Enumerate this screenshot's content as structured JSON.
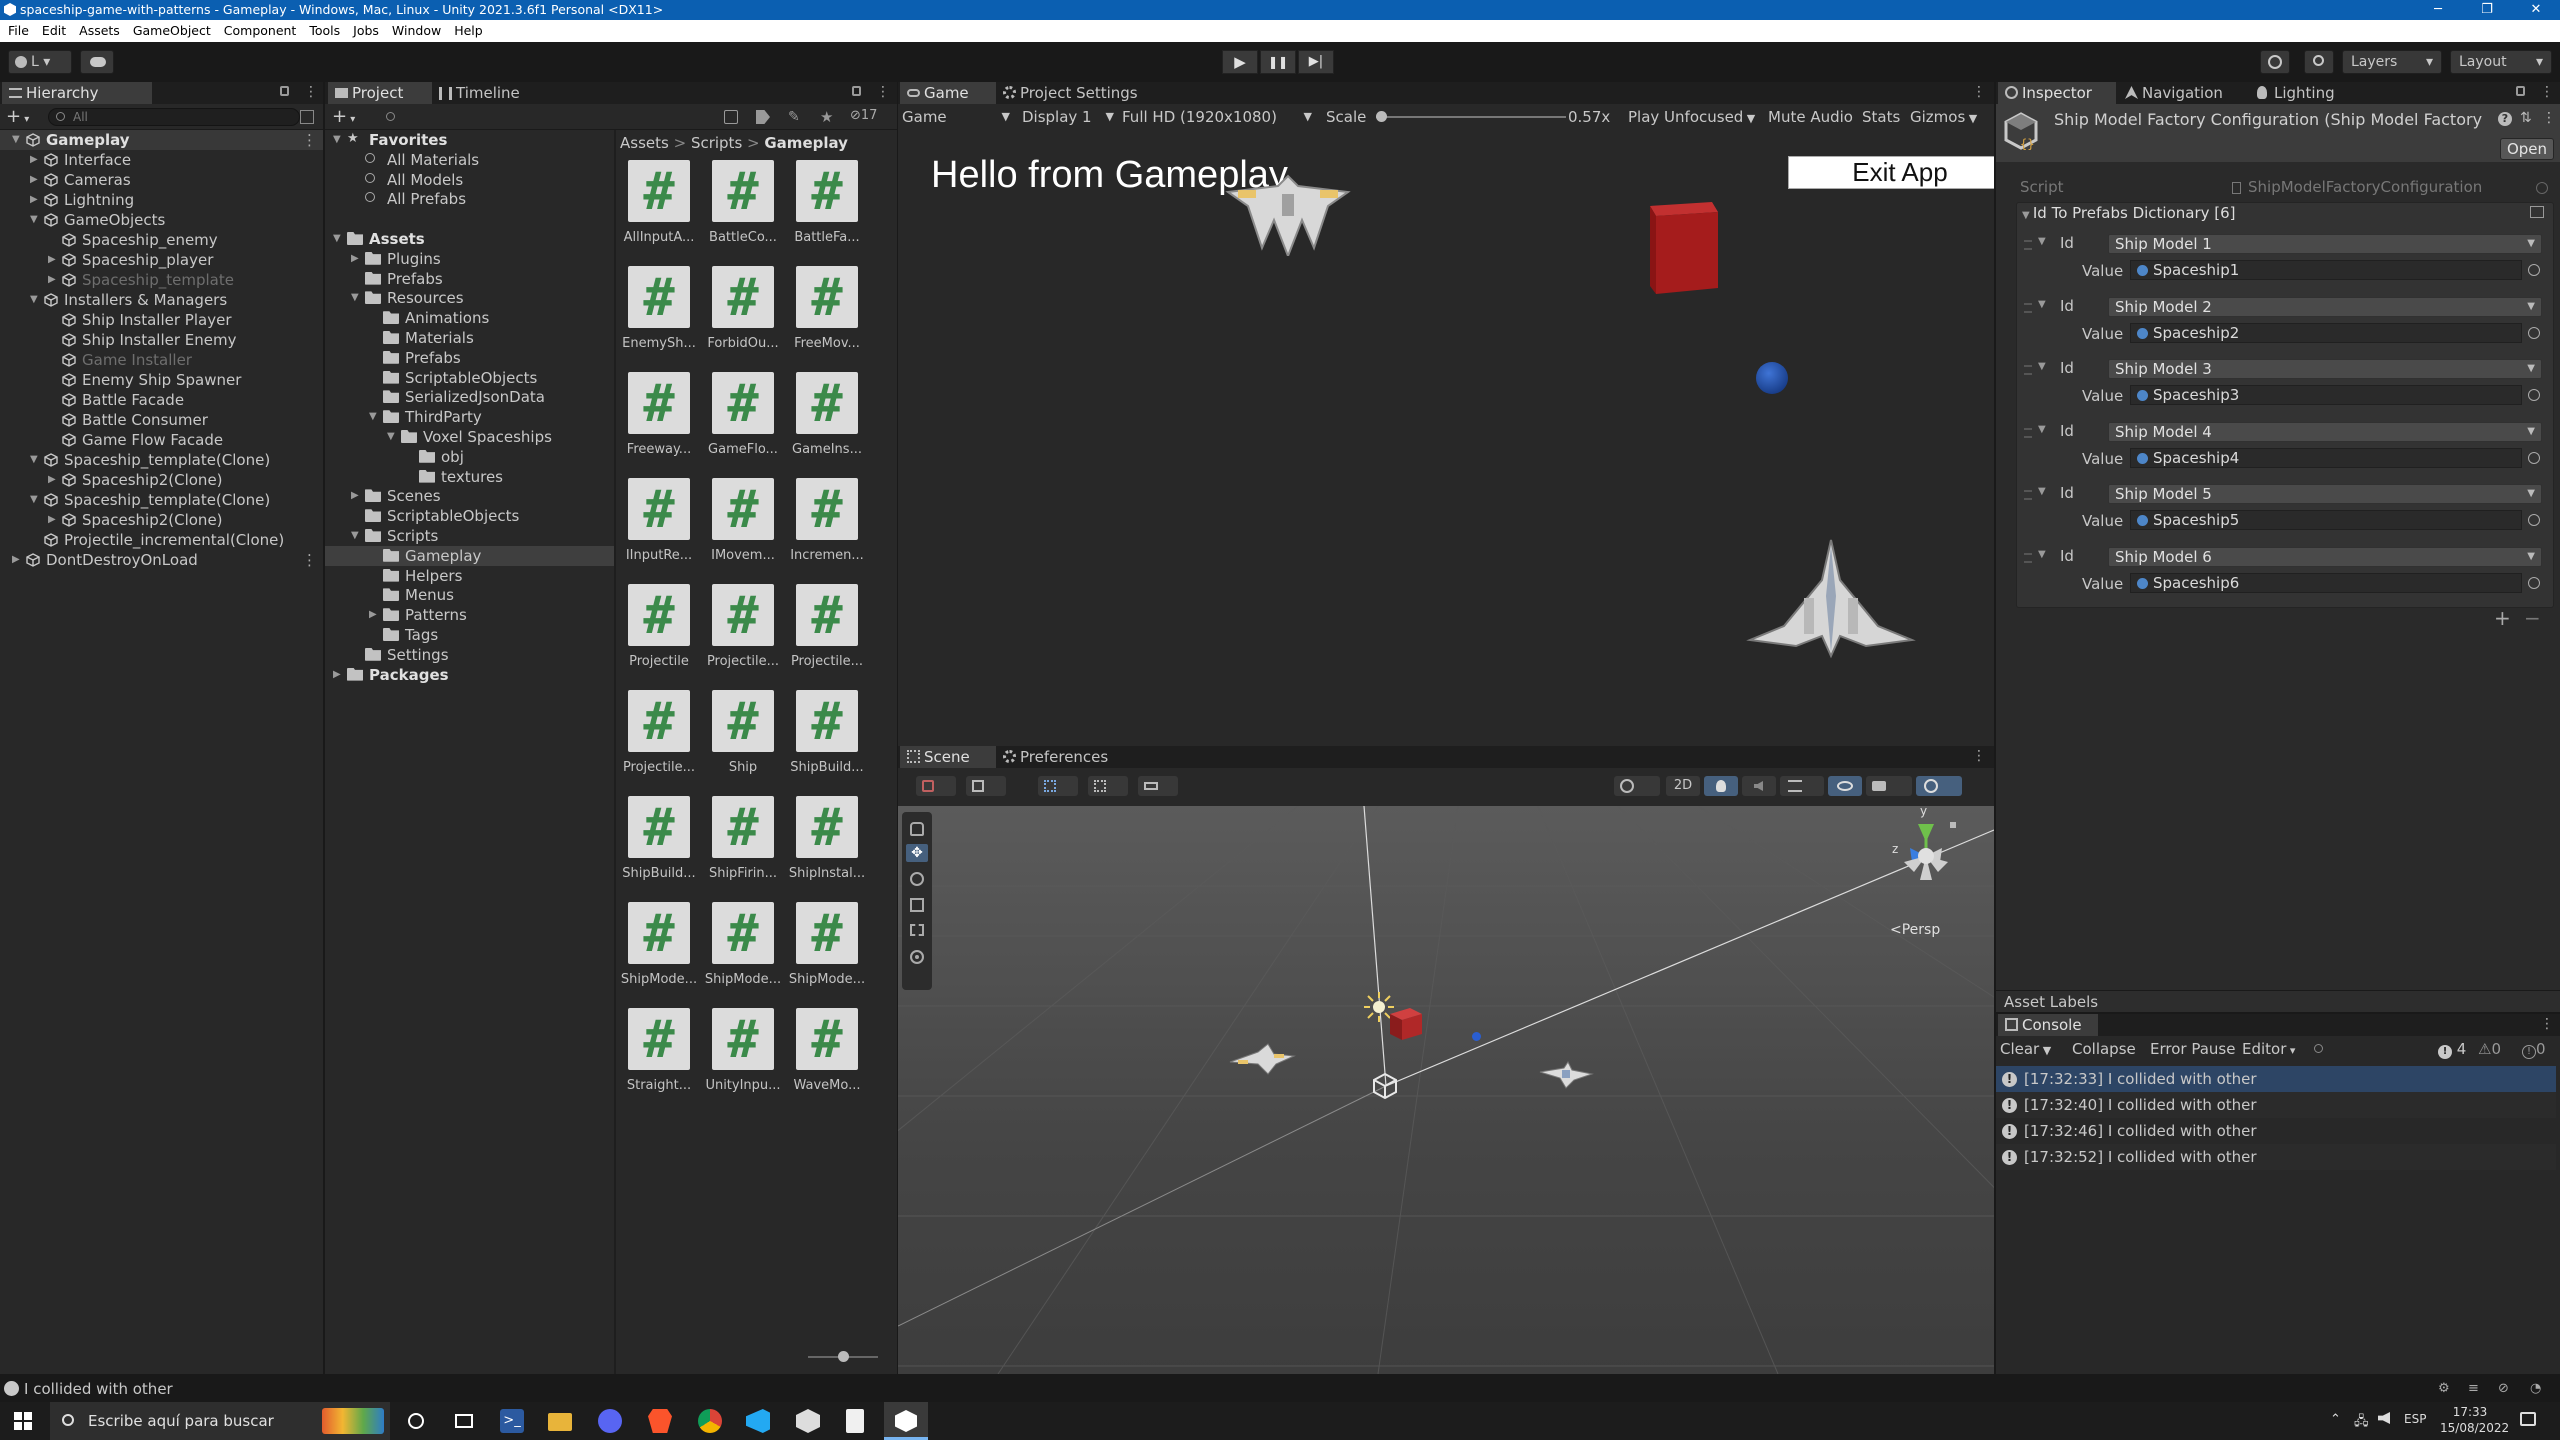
{
  "window": {
    "title": "spaceship-game-with-patterns - Gameplay - Windows, Mac, Linux - Unity 2021.3.6f1 Personal <DX11>"
  },
  "menu": [
    "File",
    "Edit",
    "Assets",
    "GameObject",
    "Component",
    "Tools",
    "Jobs",
    "Window",
    "Help"
  ],
  "toolbar": {
    "account": "L",
    "layers": "Layers",
    "layout": "Layout"
  },
  "hierarchy": {
    "tab": "Hierarchy",
    "search_placeholder": "All",
    "rows": [
      {
        "label": "Gameplay",
        "depth": 0,
        "arrow": "open",
        "icon": "scene",
        "bold": true,
        "sel": true
      },
      {
        "label": "Interface",
        "depth": 1,
        "arrow": "closed",
        "icon": "cube"
      },
      {
        "label": "Cameras",
        "depth": 1,
        "arrow": "closed",
        "icon": "cube"
      },
      {
        "label": "Lightning",
        "depth": 1,
        "arrow": "closed",
        "icon": "cube"
      },
      {
        "label": "GameObjects",
        "depth": 1,
        "arrow": "open",
        "icon": "cube"
      },
      {
        "label": "Spaceship_enemy",
        "depth": 2,
        "arrow": "none",
        "icon": "cube"
      },
      {
        "label": "Spaceship_player",
        "depth": 2,
        "arrow": "closed",
        "icon": "cube"
      },
      {
        "label": "Spaceship_template",
        "depth": 2,
        "arrow": "closed",
        "icon": "cube",
        "gray": true
      },
      {
        "label": "Installers & Managers",
        "depth": 1,
        "arrow": "open",
        "icon": "cube"
      },
      {
        "label": "Ship Installer Player",
        "depth": 2,
        "arrow": "none",
        "icon": "cube"
      },
      {
        "label": "Ship Installer Enemy",
        "depth": 2,
        "arrow": "none",
        "icon": "cube"
      },
      {
        "label": "Game Installer",
        "depth": 2,
        "arrow": "none",
        "icon": "cube",
        "gray": true
      },
      {
        "label": "Enemy Ship Spawner",
        "depth": 2,
        "arrow": "none",
        "icon": "cube"
      },
      {
        "label": "Battle Facade",
        "depth": 2,
        "arrow": "none",
        "icon": "cube"
      },
      {
        "label": "Battle Consumer",
        "depth": 2,
        "arrow": "none",
        "icon": "cube"
      },
      {
        "label": "Game Flow Facade",
        "depth": 2,
        "arrow": "none",
        "icon": "cube"
      },
      {
        "label": "Spaceship_template(Clone)",
        "depth": 1,
        "arrow": "open",
        "icon": "cube"
      },
      {
        "label": "Spaceship2(Clone)",
        "depth": 2,
        "arrow": "closed",
        "icon": "cube"
      },
      {
        "label": "Spaceship_template(Clone)",
        "depth": 1,
        "arrow": "open",
        "icon": "cube"
      },
      {
        "label": "Spaceship2(Clone)",
        "depth": 2,
        "arrow": "closed",
        "icon": "cube"
      },
      {
        "label": "Projectile_incremental(Clone)",
        "depth": 1,
        "arrow": "none",
        "icon": "cube"
      },
      {
        "label": "DontDestroyOnLoad",
        "depth": 0,
        "arrow": "closed",
        "icon": "scene"
      }
    ]
  },
  "project": {
    "tab": "Project",
    "tab2": "Timeline",
    "hidden_count": "17",
    "breadcrumb": [
      "Assets",
      "Scripts",
      "Gameplay"
    ],
    "tree": [
      {
        "label": "Favorites",
        "depth": 0,
        "arrow": "open",
        "icon": "star",
        "bold": true
      },
      {
        "label": "All Materials",
        "depth": 1,
        "arrow": "none",
        "icon": "search"
      },
      {
        "label": "All Models",
        "depth": 1,
        "arrow": "none",
        "icon": "search"
      },
      {
        "label": "All Prefabs",
        "depth": 1,
        "arrow": "none",
        "icon": "search"
      },
      {
        "label": "",
        "depth": 0,
        "arrow": "none",
        "icon": "none"
      },
      {
        "label": "Assets",
        "depth": 0,
        "arrow": "open",
        "icon": "folder",
        "bold": true
      },
      {
        "label": "Plugins",
        "depth": 1,
        "arrow": "closed",
        "icon": "folder"
      },
      {
        "label": "Prefabs",
        "depth": 1,
        "arrow": "none",
        "icon": "folder"
      },
      {
        "label": "Resources",
        "depth": 1,
        "arrow": "open",
        "icon": "folder"
      },
      {
        "label": "Animations",
        "depth": 2,
        "arrow": "none",
        "icon": "folder"
      },
      {
        "label": "Materials",
        "depth": 2,
        "arrow": "none",
        "icon": "folder"
      },
      {
        "label": "Prefabs",
        "depth": 2,
        "arrow": "none",
        "icon": "folder"
      },
      {
        "label": "ScriptableObjects",
        "depth": 2,
        "arrow": "none",
        "icon": "folder"
      },
      {
        "label": "SerializedJsonData",
        "depth": 2,
        "arrow": "none",
        "icon": "folder"
      },
      {
        "label": "ThirdParty",
        "depth": 2,
        "arrow": "open",
        "icon": "folder"
      },
      {
        "label": "Voxel Spaceships",
        "depth": 3,
        "arrow": "open",
        "icon": "folder"
      },
      {
        "label": "obj",
        "depth": 4,
        "arrow": "none",
        "icon": "folder"
      },
      {
        "label": "textures",
        "depth": 4,
        "arrow": "none",
        "icon": "folder"
      },
      {
        "label": "Scenes",
        "depth": 1,
        "arrow": "closed",
        "icon": "folder"
      },
      {
        "label": "ScriptableObjects",
        "depth": 1,
        "arrow": "none",
        "icon": "folder"
      },
      {
        "label": "Scripts",
        "depth": 1,
        "arrow": "open",
        "icon": "folder"
      },
      {
        "label": "Gameplay",
        "depth": 2,
        "arrow": "none",
        "icon": "folder",
        "sel": true
      },
      {
        "label": "Helpers",
        "depth": 2,
        "arrow": "none",
        "icon": "folder"
      },
      {
        "label": "Menus",
        "depth": 2,
        "arrow": "none",
        "icon": "folder"
      },
      {
        "label": "Patterns",
        "depth": 2,
        "arrow": "closed",
        "icon": "folder"
      },
      {
        "label": "Tags",
        "depth": 2,
        "arrow": "none",
        "icon": "folder"
      },
      {
        "label": "Settings",
        "depth": 1,
        "arrow": "none",
        "icon": "folder"
      },
      {
        "label": "Packages",
        "depth": 0,
        "arrow": "closed",
        "icon": "folder",
        "bold": true
      }
    ],
    "assets": [
      "AllInputA...",
      "BattleCo...",
      "BattleFa...",
      "EnemySh...",
      "ForbidOu...",
      "FreeMov...",
      "Freeway...",
      "GameFlo...",
      "GameIns...",
      "IInputRe...",
      "IMovem...",
      "Incremen...",
      "Projectile",
      "Projectile...",
      "Projectile...",
      "Projectile...",
      "Ship",
      "ShipBuild...",
      "ShipBuild...",
      "ShipFirin...",
      "ShipInstal...",
      "ShipMode...",
      "ShipMode...",
      "ShipMode...",
      "Straight...",
      "UnityInpu...",
      "WaveMo..."
    ]
  },
  "game": {
    "tab": "Game",
    "tab2": "Project Settings",
    "mode": "Game",
    "display": "Display 1",
    "resolution": "Full HD (1920x1080)",
    "scale_label": "Scale",
    "scale_value": "0.57x",
    "play_mode": "Play Unfocused",
    "mute": "Mute Audio",
    "stats": "Stats",
    "gizmos": "Gizmos",
    "hello": "Hello from Gameplay",
    "exit": "Exit App",
    "bg": "#1b3d7c"
  },
  "scene": {
    "tab": "Scene",
    "tab2": "Preferences",
    "mode2d": "2D",
    "persp": "<Persp",
    "axis_y": "y",
    "axis_z": "z",
    "bg": "#474747"
  },
  "inspector": {
    "tab": "Inspector",
    "tab2": "Navigation",
    "tab3": "Lighting",
    "title": "Ship Model Factory Configuration (Ship Model Factory C",
    "open": "Open",
    "script_label": "Script",
    "script_value": "ShipModelFactoryConfiguration",
    "dict_label": "Id To Prefabs Dictionary [6]",
    "entries": [
      {
        "id": "Ship Model 1",
        "value": "Spaceship1"
      },
      {
        "id": "Ship Model 2",
        "value": "Spaceship2"
      },
      {
        "id": "Ship Model 3",
        "value": "Spaceship3"
      },
      {
        "id": "Ship Model 4",
        "value": "Spaceship4"
      },
      {
        "id": "Ship Model 5",
        "value": "Spaceship5"
      },
      {
        "id": "Ship Model 6",
        "value": "Spaceship6"
      }
    ],
    "id_label": "Id",
    "value_label": "Value",
    "asset_labels": "Asset Labels"
  },
  "console": {
    "tab": "Console",
    "clear": "Clear",
    "collapse": "Collapse",
    "error_pause": "Error Pause",
    "editor": "Editor",
    "counts": {
      "log": "4",
      "warn": "0",
      "err": "0"
    },
    "rows": [
      "[17:32:33] I collided with other",
      "[17:32:40] I collided with other",
      "[17:32:46] I collided with other",
      "[17:32:52] I collided with other"
    ]
  },
  "status": {
    "message": "I collided with other"
  },
  "taskbar": {
    "search": "Escribe aquí para buscar",
    "lang": "ESP",
    "time": "17:33",
    "date": "15/08/2022"
  }
}
